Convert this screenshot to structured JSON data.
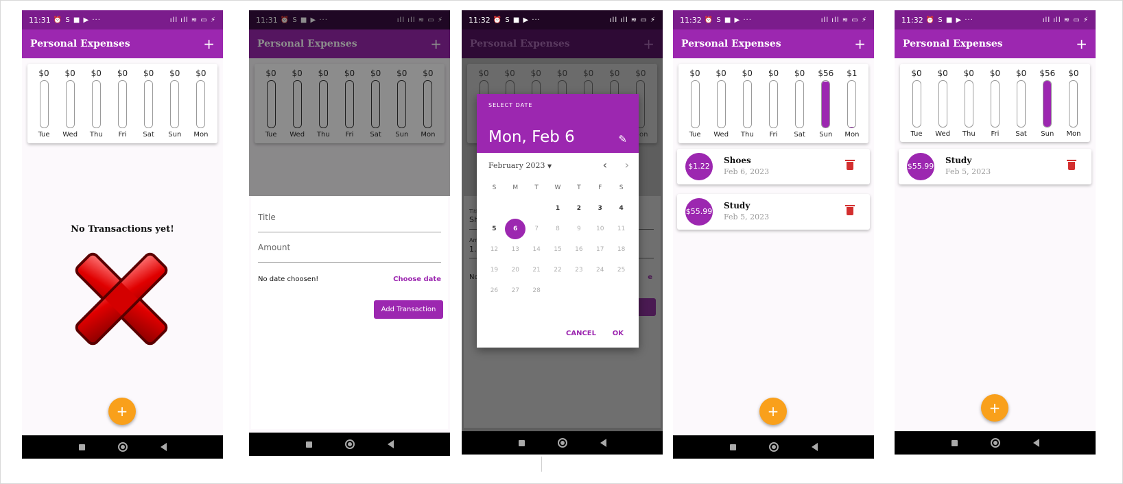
{
  "status": {
    "icons": "⏰ S ■ ▶ ···",
    "right": "ıll ıll ≋ ▭ ⚡"
  },
  "colors": {
    "primary": "#9c27b0",
    "primary_dark": "#7b1c8c",
    "accent": "#f9a01b",
    "danger": "#d32f2f"
  },
  "screens": [
    {
      "time": "11:31",
      "app_title": "Personal Expenses",
      "add_label": "+",
      "chart": [
        {
          "amount": "$0",
          "day": "Tue",
          "fill": 0
        },
        {
          "amount": "$0",
          "day": "Wed",
          "fill": 0
        },
        {
          "amount": "$0",
          "day": "Thu",
          "fill": 0
        },
        {
          "amount": "$0",
          "day": "Fri",
          "fill": 0
        },
        {
          "amount": "$0",
          "day": "Sat",
          "fill": 0
        },
        {
          "amount": "$0",
          "day": "Sun",
          "fill": 0
        },
        {
          "amount": "$0",
          "day": "Mon",
          "fill": 0
        }
      ],
      "empty_message": "No Transactions yet!",
      "fab_label": "+"
    },
    {
      "time": "11:31",
      "app_title": "Personal Expenses",
      "add_label": "+",
      "chart": [
        {
          "amount": "$0",
          "day": "Tue",
          "fill": 0
        },
        {
          "amount": "$0",
          "day": "Wed",
          "fill": 0
        },
        {
          "amount": "$0",
          "day": "Thu",
          "fill": 0
        },
        {
          "amount": "$0",
          "day": "Fri",
          "fill": 0
        },
        {
          "amount": "$0",
          "day": "Sat",
          "fill": 0
        },
        {
          "amount": "$0",
          "day": "Sun",
          "fill": 0
        },
        {
          "amount": "$0",
          "day": "Mon",
          "fill": 0
        }
      ],
      "form": {
        "title_placeholder": "Title",
        "amount_placeholder": "Amount",
        "date_status": "No date choosen!",
        "choose_date": "Choose date",
        "submit": "Add Transaction"
      }
    },
    {
      "time": "11:32",
      "app_title": "Personal Expenses",
      "add_label": "+",
      "chart": [
        {
          "amount": "$0",
          "day": "Tue",
          "fill": 0
        },
        {
          "amount": "$0",
          "day": "Wed",
          "fill": 0
        },
        {
          "amount": "$0",
          "day": "Thu",
          "fill": 0
        },
        {
          "amount": "$0",
          "day": "Fri",
          "fill": 0
        },
        {
          "amount": "$0",
          "day": "Sat",
          "fill": 0
        },
        {
          "amount": "$0",
          "day": "Sun",
          "fill": 0
        },
        {
          "amount": "$0",
          "day": "Mon",
          "fill": 0
        }
      ],
      "form_peek": {
        "title_label": "Title",
        "title_value": "Sh",
        "amount_label": "Am",
        "amount_value": "1.2",
        "date_status": "No",
        "choose_date_tail": "e"
      },
      "date_picker": {
        "caption": "SELECT DATE",
        "selected_date": "Mon, Feb 6",
        "month_label": "February 2023",
        "weekdays": [
          "S",
          "M",
          "T",
          "W",
          "T",
          "F",
          "S"
        ],
        "weeks": [
          [
            "",
            "",
            "",
            "1",
            "2",
            "3",
            "4"
          ],
          [
            "5",
            "6",
            "7",
            "8",
            "9",
            "10",
            "11"
          ],
          [
            "12",
            "13",
            "14",
            "15",
            "16",
            "17",
            "18"
          ],
          [
            "19",
            "20",
            "21",
            "22",
            "23",
            "24",
            "25"
          ],
          [
            "26",
            "27",
            "28",
            "",
            "",
            "",
            ""
          ]
        ],
        "selected_day": "6",
        "last_enabled_day": 6,
        "cancel": "CANCEL",
        "ok": "OK"
      }
    },
    {
      "time": "11:32",
      "app_title": "Personal Expenses",
      "add_label": "+",
      "chart": [
        {
          "amount": "$0",
          "day": "Tue",
          "fill": 0
        },
        {
          "amount": "$0",
          "day": "Wed",
          "fill": 0
        },
        {
          "amount": "$0",
          "day": "Thu",
          "fill": 0
        },
        {
          "amount": "$0",
          "day": "Fri",
          "fill": 0
        },
        {
          "amount": "$0",
          "day": "Sat",
          "fill": 0
        },
        {
          "amount": "$56",
          "day": "Sun",
          "fill": 0.98
        },
        {
          "amount": "$1",
          "day": "Mon",
          "fill": 0.02
        }
      ],
      "transactions": [
        {
          "amount": "$1.22",
          "title": "Shoes",
          "date": "Feb 6, 2023"
        },
        {
          "amount": "$55.99",
          "title": "Study",
          "date": "Feb 5, 2023"
        }
      ],
      "fab_label": "+"
    },
    {
      "time": "11:32",
      "app_title": "Personal Expenses",
      "add_label": "+",
      "chart": [
        {
          "amount": "$0",
          "day": "Tue",
          "fill": 0
        },
        {
          "amount": "$0",
          "day": "Wed",
          "fill": 0
        },
        {
          "amount": "$0",
          "day": "Thu",
          "fill": 0
        },
        {
          "amount": "$0",
          "day": "Fri",
          "fill": 0
        },
        {
          "amount": "$0",
          "day": "Sat",
          "fill": 0
        },
        {
          "amount": "$56",
          "day": "Sun",
          "fill": 1.0
        },
        {
          "amount": "$0",
          "day": "Mon",
          "fill": 0
        }
      ],
      "transactions": [
        {
          "amount": "$55.99",
          "title": "Study",
          "date": "Feb 5, 2023"
        }
      ],
      "fab_label": "+"
    }
  ]
}
